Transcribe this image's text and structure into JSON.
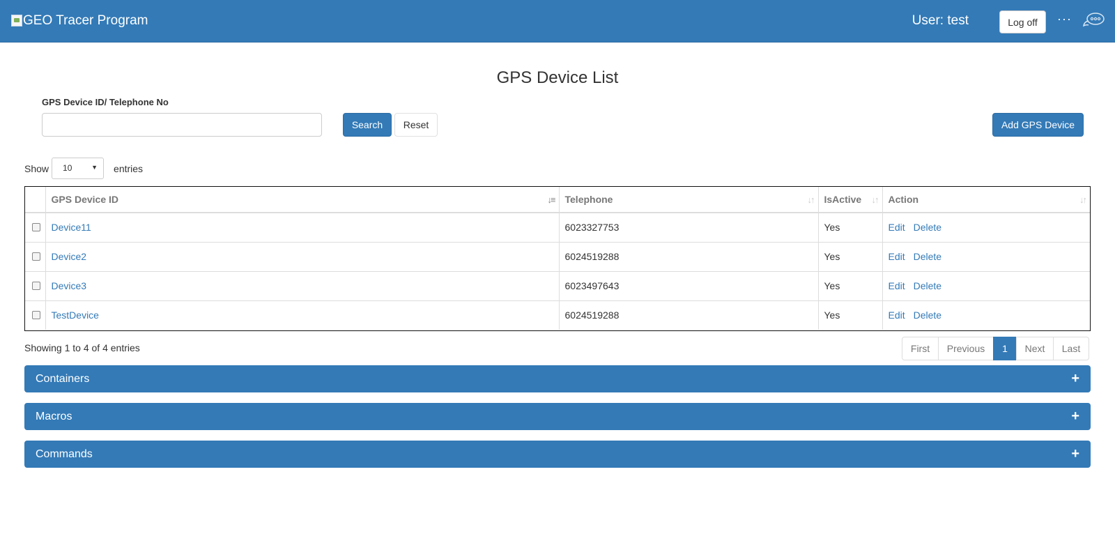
{
  "header": {
    "brand": "GEO Tracer Program",
    "user_label": "User: test",
    "logoff_label": "Log off",
    "more_label": "···"
  },
  "page": {
    "title": "GPS Device List",
    "search_label": "GPS Device ID/ Telephone No",
    "search_value": "",
    "search_button": "Search",
    "reset_button": "Reset",
    "add_button": "Add GPS Device"
  },
  "length_menu": {
    "show_label": "Show",
    "selected": "10",
    "entries_label": "entries"
  },
  "table": {
    "columns": [
      "GPS Device ID",
      "Telephone",
      "IsActive",
      "Action"
    ],
    "edit_label": "Edit",
    "delete_label": "Delete",
    "rows": [
      {
        "device_id": "Device11",
        "telephone": "6023327753",
        "active": "Yes"
      },
      {
        "device_id": "Device2",
        "telephone": "6024519288",
        "active": "Yes"
      },
      {
        "device_id": "Device3",
        "telephone": "6023497643",
        "active": "Yes"
      },
      {
        "device_id": "TestDevice",
        "telephone": "6024519288",
        "active": "Yes"
      }
    ]
  },
  "footer": {
    "info": "Showing 1 to 4 of 4 entries",
    "pagination": [
      "First",
      "Previous",
      "1",
      "Next",
      "Last"
    ],
    "active_page": "1"
  },
  "panels": [
    {
      "title": "Containers",
      "toggle": "+"
    },
    {
      "title": "Macros",
      "toggle": "+"
    },
    {
      "title": "Commands",
      "toggle": "+"
    }
  ],
  "colors": {
    "primary": "#337ab7",
    "link": "#337ab7"
  }
}
